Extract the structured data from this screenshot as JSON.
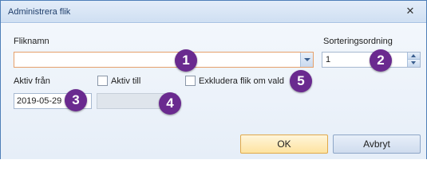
{
  "window": {
    "title": "Administrera flik",
    "close_glyph": "✕"
  },
  "form": {
    "tab_name_label": "Fliknamn",
    "tab_name_value": "",
    "sort_order_label": "Sorteringsordning",
    "sort_order_value": "1",
    "active_from_label": "Aktiv från",
    "active_from_value": "2019-05-29",
    "active_to_label": "Aktiv till",
    "active_to_checked": false,
    "exclude_label": "Exkludera flik om vald",
    "exclude_checked": false
  },
  "badges": [
    "1",
    "2",
    "3",
    "4",
    "5"
  ],
  "buttons": {
    "ok": "OK",
    "cancel": "Avbryt"
  },
  "colors": {
    "badge": "#6a2a8f",
    "focus_border": "#e6a06b",
    "title_text": "#1f3e6b"
  }
}
